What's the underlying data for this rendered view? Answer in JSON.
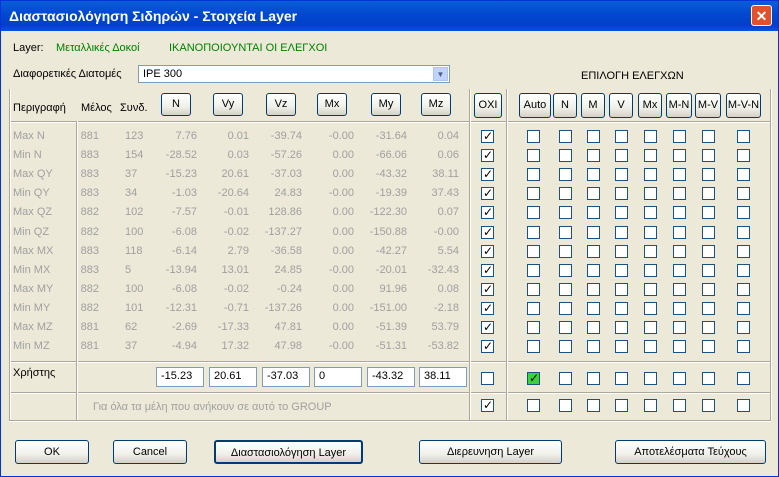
{
  "window": {
    "title": "Διαστασιολόγηση Σιδηρών - Στοιχεία Layer",
    "close_icon": "close-icon"
  },
  "layer": {
    "label": "Layer:",
    "name": "Μεταλλικές Δοκοί",
    "status": "ΙΚΑΝΟΠΟΙΟΥΝΤΑΙ ΟΙ ΕΛΕΓΧΟΙ"
  },
  "section": {
    "label": "Διαφορετικές Διατομές",
    "selected": "IPE 300"
  },
  "checks_title": "ΕΠΙΛΟΓΗ ΕΛΕΓΧΩΝ",
  "headers": {
    "description": "Περιγραφή",
    "member": "Μέλος",
    "combo": "Συνδ."
  },
  "sort_buttons": [
    "N",
    "Vy",
    "Vz",
    "Mx",
    "My",
    "Mz"
  ],
  "oxi_button": "ΟΧΙ",
  "check_buttons": [
    "Auto",
    "N",
    "M",
    "V",
    "Mx",
    "M-N",
    "M-V",
    "M-V-N"
  ],
  "rows": [
    {
      "label": "Max N",
      "member": "881",
      "combo": "123",
      "vals": [
        "7.76",
        "0.01",
        "-39.74",
        "-0.00",
        "-31.64",
        "0.04"
      ]
    },
    {
      "label": "Min N",
      "member": "883",
      "combo": "154",
      "vals": [
        "-28.52",
        "0.03",
        "-57.26",
        "0.00",
        "-66.06",
        "0.06"
      ]
    },
    {
      "label": "Max QY",
      "member": "883",
      "combo": "37",
      "vals": [
        "-15.23",
        "20.61",
        "-37.03",
        "0.00",
        "-43.32",
        "38.11"
      ]
    },
    {
      "label": "Min QY",
      "member": "883",
      "combo": "34",
      "vals": [
        "-1.03",
        "-20.64",
        "24.83",
        "-0.00",
        "-19.39",
        "37.43"
      ]
    },
    {
      "label": "Max QZ",
      "member": "882",
      "combo": "102",
      "vals": [
        "-7.57",
        "-0.01",
        "128.86",
        "0.00",
        "-122.30",
        "0.07"
      ]
    },
    {
      "label": "Min QZ",
      "member": "882",
      "combo": "100",
      "vals": [
        "-6.08",
        "-0.02",
        "-137.27",
        "0.00",
        "-150.88",
        "-0.00"
      ]
    },
    {
      "label": "Max MX",
      "member": "883",
      "combo": "118",
      "vals": [
        "-6.14",
        "2.79",
        "-36.58",
        "0.00",
        "-42.27",
        "5.54"
      ]
    },
    {
      "label": "Min MX",
      "member": "883",
      "combo": "5",
      "vals": [
        "-13.94",
        "13.01",
        "24.85",
        "-0.00",
        "-20.01",
        "-32.43"
      ]
    },
    {
      "label": "Max MY",
      "member": "882",
      "combo": "100",
      "vals": [
        "-6.08",
        "-0.02",
        "-0.24",
        "0.00",
        "91.96",
        "0.08"
      ]
    },
    {
      "label": "Min MY",
      "member": "882",
      "combo": "101",
      "vals": [
        "-12.31",
        "-0.71",
        "-137.26",
        "0.00",
        "-151.00",
        "-2.18"
      ]
    },
    {
      "label": "Max MZ",
      "member": "881",
      "combo": "62",
      "vals": [
        "-2.69",
        "-17.33",
        "47.81",
        "0.00",
        "-51.39",
        "53.79"
      ]
    },
    {
      "label": "Min MZ",
      "member": "881",
      "combo": "37",
      "vals": [
        "-4.94",
        "17.32",
        "47.98",
        "-0.00",
        "-51.31",
        "-53.82"
      ]
    }
  ],
  "user_row": {
    "label": "Χρήστης",
    "vals": [
      "-15.23",
      "20.61",
      "-37.03",
      "0",
      "-43.32",
      "38.11"
    ]
  },
  "group_note": "Για όλα τα μέλη που ανήκουν σε αυτό το GROUP",
  "footer": {
    "ok": "OK",
    "cancel": "Cancel",
    "dimension": "Διαστασιολόγηση Layer",
    "investigate": "Διερευνηση Layer",
    "results": "Αποτελέσματα Τεύχους"
  }
}
